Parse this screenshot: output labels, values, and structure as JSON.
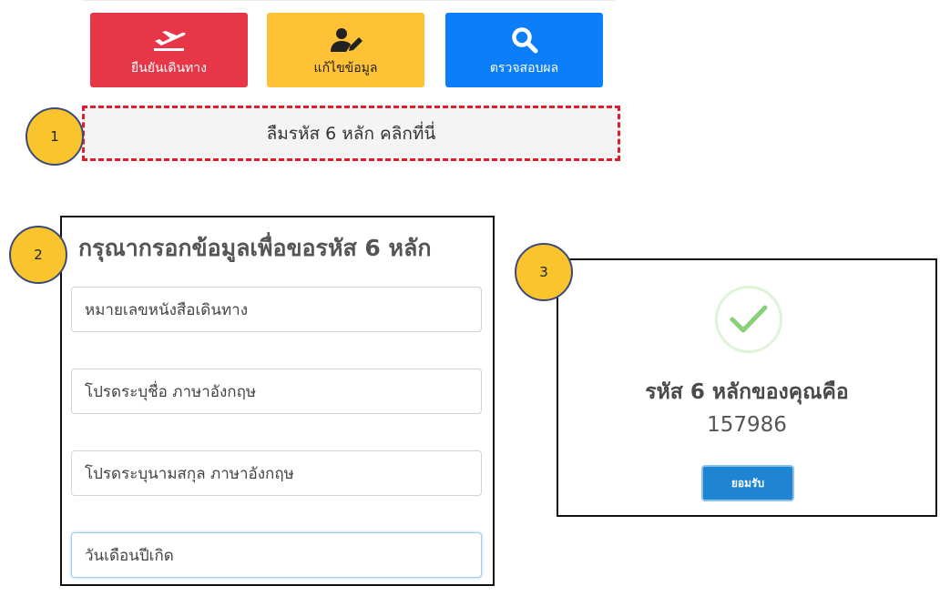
{
  "nav": {
    "confirm": {
      "label": "ยืนยันเดินทาง",
      "icon": "airplane-takeoff-icon",
      "color": "#e63647"
    },
    "edit": {
      "label": "แก้ไขข้อมูล",
      "icon": "user-edit-icon",
      "color": "#ffc236"
    },
    "check": {
      "label": "ตรวจสอบผล",
      "icon": "search-icon",
      "color": "#0d7ef9"
    }
  },
  "forgot_link": "ลืมรหัส 6 หลัก คลิกที่นี่",
  "badges": {
    "one": "1",
    "two": "2",
    "three": "3"
  },
  "request_form": {
    "title": "กรุณากรอกข้อมูลเพื่อขอรหัส 6 หลัก",
    "fields": [
      {
        "placeholder": "หมายเลขหนังสือเดินทาง"
      },
      {
        "placeholder": "โปรดระบุชื่อ ภาษาอังกฤษ"
      },
      {
        "placeholder": "โปรดระบุนามสกุล ภาษาอังกฤษ"
      },
      {
        "placeholder": "วันเดือนปีเกิด"
      }
    ]
  },
  "result": {
    "label": "รหัส 6 หลักของคุณคือ",
    "code": "157986",
    "accept_label": "ยอมรับ",
    "icon": "check-icon"
  }
}
